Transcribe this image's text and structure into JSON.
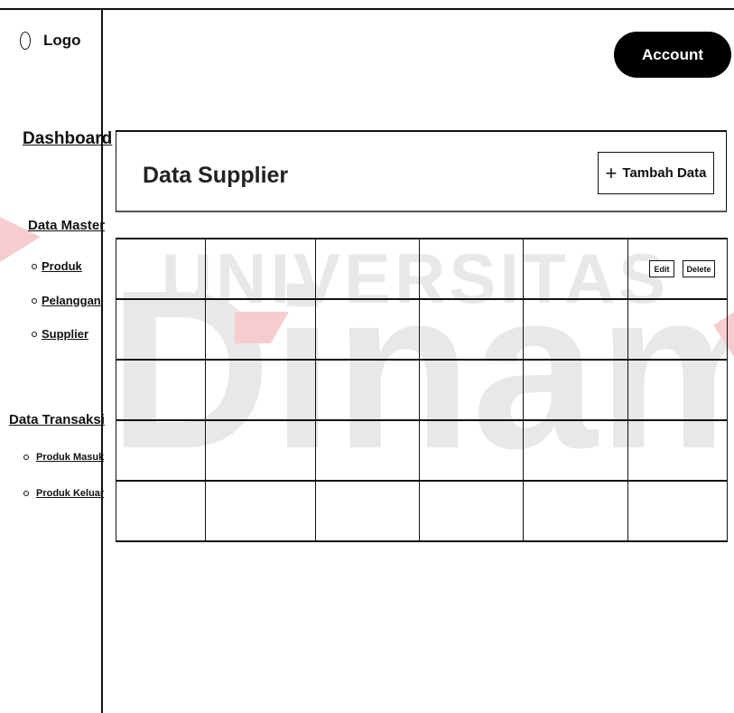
{
  "logo": {
    "label": "Logo"
  },
  "sidebar": {
    "dashboard": "Dashboard",
    "master": {
      "title": "Data Master",
      "items": [
        "Produk",
        "Pelanggan",
        "Supplier"
      ]
    },
    "transaksi": {
      "title": "Data Transaksi",
      "items": [
        "Produk Masuk",
        "Produk Keluar"
      ]
    }
  },
  "header": {
    "account": "Account"
  },
  "main": {
    "title": "Data Supplier",
    "add_button": "Tambah Data",
    "table": {
      "columns": 6,
      "rows": 5,
      "edit_label": "Edit",
      "delete_label": "Delete"
    }
  },
  "watermark": {
    "top_text": "UNIVERSITAS",
    "bottom_text": "Dinamika",
    "colors": {
      "red": "#d9222a",
      "grey": "#d4d4d4"
    }
  },
  "colors": {
    "line": "#111111",
    "account_bg": "#000000"
  }
}
